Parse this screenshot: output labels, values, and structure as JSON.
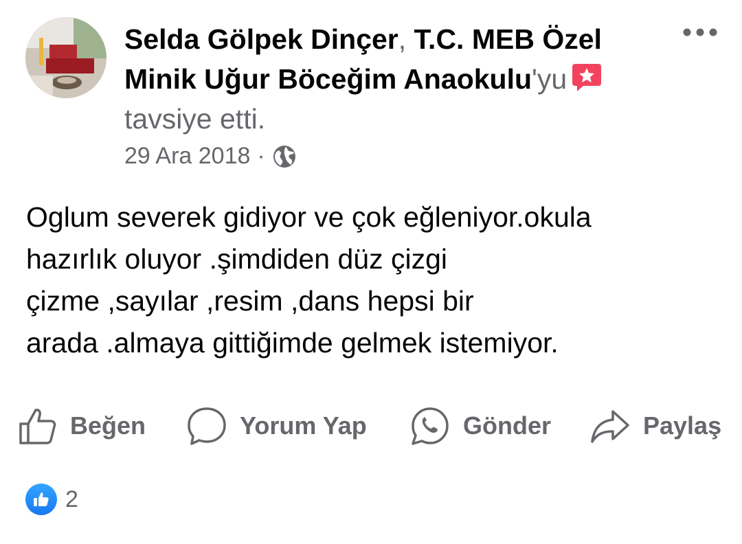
{
  "post": {
    "author": "Selda Gölpek Dinçer",
    "separator": ", ",
    "page_name": "T.C. MEB Özel Minik Uğur Böceğim Anaokulu",
    "suffix": "'yu",
    "action_text": "tavsiye etti.",
    "date": "29 Ara 2018",
    "dot": "·",
    "privacy_icon": "globe-icon",
    "recommend_icon": "recommend-star-icon",
    "body_lines": [
      "Oglum severek gidiyor ve çok eğleniyor.okula",
      "hazırlık oluyor .şimdiden düz çizgi",
      "çizme ,sayılar ,resim ,dans hepsi bir",
      "arada .almaya gittiğimde gelmek istemiyor."
    ]
  },
  "actions": {
    "like": "Beğen",
    "comment": "Yorum Yap",
    "send": "Gönder",
    "share": "Paylaş"
  },
  "reactions": {
    "icon": "like-reaction-icon",
    "count": "2"
  },
  "colors": {
    "text": "#050505",
    "secondary": "#65676b",
    "like_blue": "#1877f2",
    "recommend_red": "#f3425f"
  }
}
